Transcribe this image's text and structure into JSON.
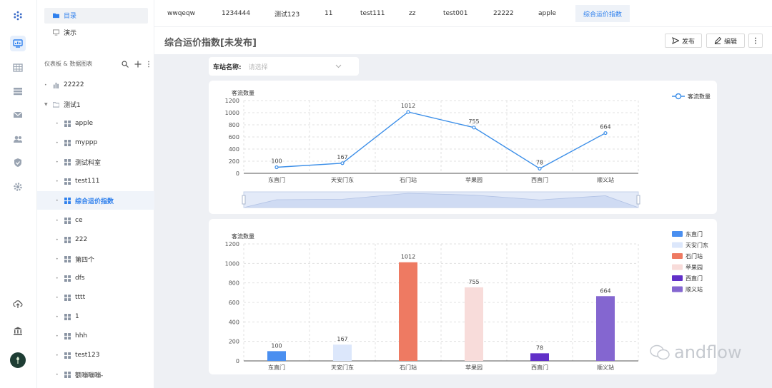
{
  "sidebar": {
    "top_items": [
      {
        "label": "目录",
        "icon": "folder-icon"
      },
      {
        "label": "演示",
        "icon": "monitor-icon"
      }
    ],
    "section_title": "仪表板 & 数据图表",
    "tree": [
      {
        "label": "22222",
        "icon": "bar-chart-icon",
        "level": 0
      },
      {
        "label": "测试1",
        "icon": "folder-icon",
        "level": 0,
        "expanded": true
      },
      {
        "label": "apple",
        "icon": "dashboard-icon",
        "level": 1
      },
      {
        "label": "myppp",
        "icon": "dashboard-icon",
        "level": 1
      },
      {
        "label": "测试科室",
        "icon": "dashboard-icon",
        "level": 1
      },
      {
        "label": "test111",
        "icon": "dashboard-icon",
        "level": 1
      },
      {
        "label": "综合运价指数",
        "icon": "dashboard-icon",
        "level": 1,
        "active": true
      },
      {
        "label": "ce",
        "icon": "dashboard-icon",
        "level": 1
      },
      {
        "label": "222",
        "icon": "dashboard-icon",
        "level": 1
      },
      {
        "label": "第四个",
        "icon": "dashboard-icon",
        "level": 1
      },
      {
        "label": "dfs",
        "icon": "dashboard-icon",
        "level": 1
      },
      {
        "label": "tttt",
        "icon": "dashboard-icon",
        "level": 1
      },
      {
        "label": "1",
        "icon": "dashboard-icon",
        "level": 1
      },
      {
        "label": "hhh",
        "icon": "dashboard-icon",
        "level": 1
      },
      {
        "label": "test123",
        "icon": "dashboard-icon",
        "level": 1
      },
      {
        "label": "额嘣嘣嘣-",
        "icon": "dashboard-icon",
        "level": 1
      }
    ]
  },
  "tabs": [
    "wwqeqw",
    "1234444",
    "测试123",
    "11",
    "test111",
    "zz",
    "test001",
    "22222",
    "apple",
    "综合运价指数"
  ],
  "active_tab": "综合运价指数",
  "header": {
    "title": "综合运价指数[未发布]",
    "publish": "发布",
    "edit": "编辑"
  },
  "filter": {
    "label": "车站名称:",
    "placeholder": "请选择"
  },
  "watermark": "andflow",
  "colors": {
    "accent": "#2f80ed",
    "line": "#3b8ee8"
  },
  "chart_data": [
    {
      "type": "line",
      "ylabel": "客流数量",
      "categories": [
        "东直门",
        "天安门东",
        "石门站",
        "苹果园",
        "西直门",
        "顺义站"
      ],
      "series": [
        {
          "name": "客流数量",
          "values": [
            100,
            167,
            1012,
            755,
            78,
            664
          ]
        }
      ],
      "ylim": [
        0,
        1200
      ],
      "yticks": [
        0,
        200,
        400,
        600,
        800,
        1000,
        1200
      ],
      "grid": true,
      "legend": "top-right",
      "datazoom": true
    },
    {
      "type": "bar",
      "ylabel": "客流数量",
      "categories": [
        "东直门",
        "天安门东",
        "石门站",
        "苹果园",
        "西直门",
        "顺义站"
      ],
      "values": [
        100,
        167,
        1012,
        755,
        78,
        664
      ],
      "bar_colors": [
        "#4a8ff0",
        "#dce7fb",
        "#ee7a62",
        "#f8dcda",
        "#6130c8",
        "#8466d0"
      ],
      "legend_entries": [
        "东直门",
        "天安门东",
        "石门站",
        "苹果园",
        "西直门",
        "顺义站"
      ],
      "ylim": [
        0,
        1200
      ],
      "yticks": [
        0,
        200,
        400,
        600,
        800,
        1000,
        1200
      ],
      "grid": true,
      "legend": "top-right"
    }
  ]
}
